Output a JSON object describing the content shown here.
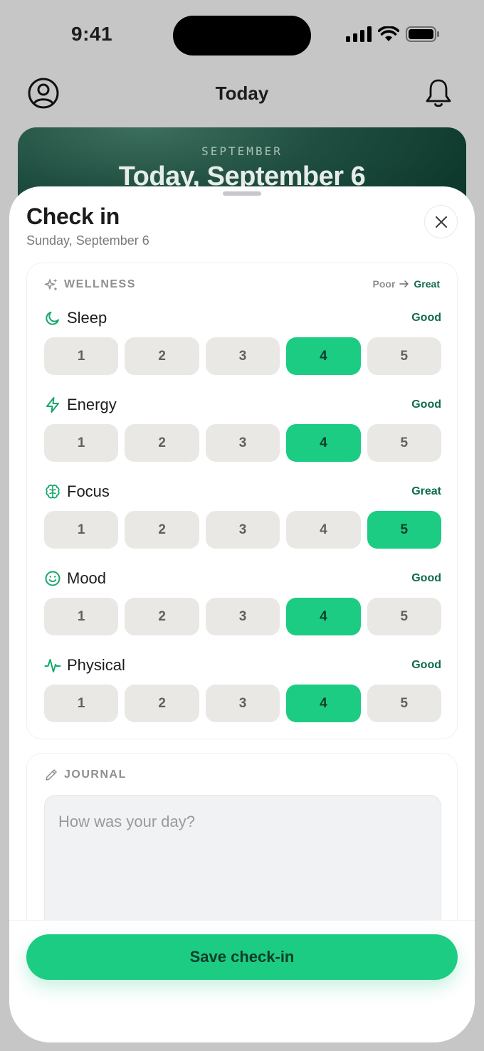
{
  "status_bar": {
    "time": "9:41"
  },
  "header": {
    "title": "Today"
  },
  "hero": {
    "month": "SEPTEMBER",
    "title": "Today, September 6"
  },
  "sheet": {
    "title": "Check in",
    "subtitle": "Sunday, September 6"
  },
  "wellness": {
    "label": "WELLNESS",
    "scale_low": "Poor",
    "scale_high": "Great",
    "metrics": [
      {
        "name": "Sleep",
        "level": "Good",
        "icon": "moon-icon",
        "selected": 4,
        "options": [
          "1",
          "2",
          "3",
          "4",
          "5"
        ]
      },
      {
        "name": "Energy",
        "level": "Good",
        "icon": "lightning-icon",
        "selected": 4,
        "options": [
          "1",
          "2",
          "3",
          "4",
          "5"
        ]
      },
      {
        "name": "Focus",
        "level": "Great",
        "icon": "brain-icon",
        "selected": 5,
        "options": [
          "1",
          "2",
          "3",
          "4",
          "5"
        ]
      },
      {
        "name": "Mood",
        "level": "Good",
        "icon": "smile-icon",
        "selected": 4,
        "options": [
          "1",
          "2",
          "3",
          "4",
          "5"
        ]
      },
      {
        "name": "Physical",
        "level": "Good",
        "icon": "activity-icon",
        "selected": 4,
        "options": [
          "1",
          "2",
          "3",
          "4",
          "5"
        ]
      }
    ]
  },
  "journal": {
    "label": "JOURNAL",
    "placeholder": "How was your day?",
    "value": ""
  },
  "actions": {
    "save_label": "Save check-in"
  },
  "colors": {
    "accent": "#1ccc83",
    "accent_text": "#0f6b4c",
    "hero_bg": "#0e3a2d"
  }
}
